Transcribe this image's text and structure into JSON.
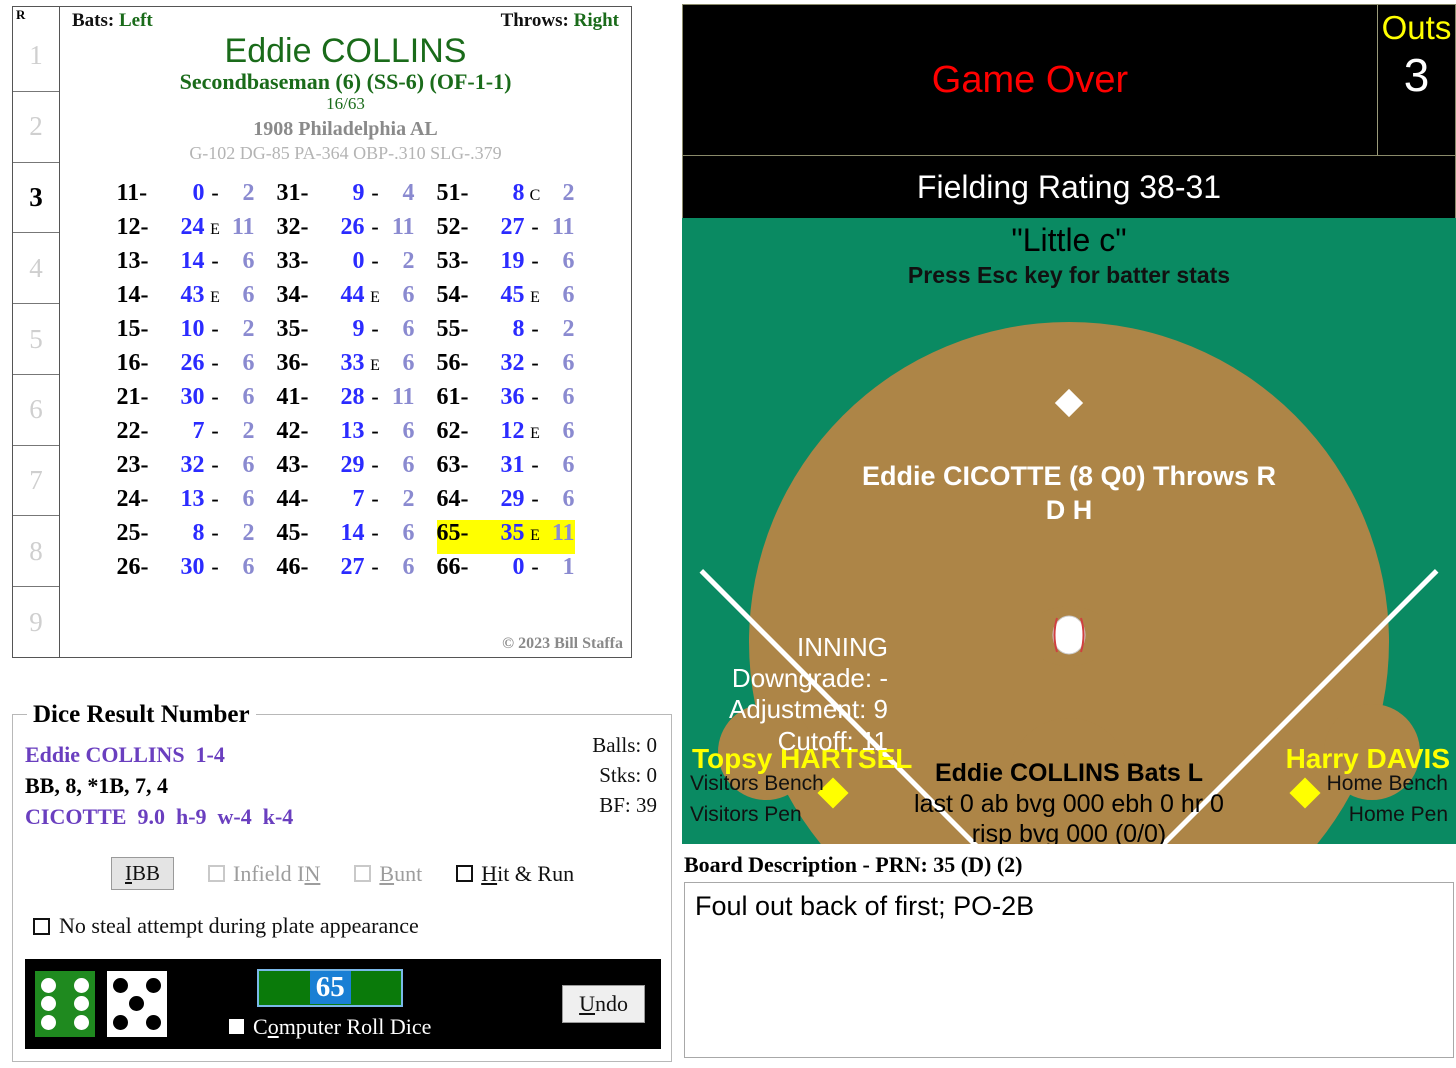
{
  "card": {
    "bats_label": "Bats:",
    "bats_value": "Left",
    "throws_label": "Throws:",
    "throws_value": "Right",
    "player_name": "Eddie COLLINS",
    "position": "Secondbaseman (6) (SS-6) (OF-1-1)",
    "ratio": "16/63",
    "team": "1908 Philadelphia AL",
    "stats_line": "G-102 DG-85 PA-364 OBP-.310 SLG-.379",
    "copyright": "© 2023 Bill Staffa",
    "inning_header": "R",
    "innings": [
      "1",
      "2",
      "3",
      "4",
      "5",
      "6",
      "7",
      "8",
      "9"
    ],
    "current_inning": "3",
    "dice_columns": [
      [
        {
          "key": "11-",
          "main": "0",
          "mid": "-",
          "sec": "2"
        },
        {
          "key": "12-",
          "main": "24",
          "mid": "E",
          "sec": "11"
        },
        {
          "key": "13-",
          "main": "14",
          "mid": "-",
          "sec": "6"
        },
        {
          "key": "14-",
          "main": "43",
          "mid": "E",
          "sec": "6"
        },
        {
          "key": "15-",
          "main": "10",
          "mid": "-",
          "sec": "2"
        },
        {
          "key": "16-",
          "main": "26",
          "mid": "-",
          "sec": "6"
        },
        {
          "key": "21-",
          "main": "30",
          "mid": "-",
          "sec": "6"
        },
        {
          "key": "22-",
          "main": "7",
          "mid": "-",
          "sec": "2"
        },
        {
          "key": "23-",
          "main": "32",
          "mid": "-",
          "sec": "6"
        },
        {
          "key": "24-",
          "main": "13",
          "mid": "-",
          "sec": "6"
        },
        {
          "key": "25-",
          "main": "8",
          "mid": "-",
          "sec": "2"
        },
        {
          "key": "26-",
          "main": "30",
          "mid": "-",
          "sec": "6"
        }
      ],
      [
        {
          "key": "31-",
          "main": "9",
          "mid": "-",
          "sec": "4"
        },
        {
          "key": "32-",
          "main": "26",
          "mid": "-",
          "sec": "11"
        },
        {
          "key": "33-",
          "main": "0",
          "mid": "-",
          "sec": "2"
        },
        {
          "key": "34-",
          "main": "44",
          "mid": "E",
          "sec": "6"
        },
        {
          "key": "35-",
          "main": "9",
          "mid": "-",
          "sec": "6"
        },
        {
          "key": "36-",
          "main": "33",
          "mid": "E",
          "sec": "6"
        },
        {
          "key": "41-",
          "main": "28",
          "mid": "-",
          "sec": "11"
        },
        {
          "key": "42-",
          "main": "13",
          "mid": "-",
          "sec": "6"
        },
        {
          "key": "43-",
          "main": "29",
          "mid": "-",
          "sec": "6"
        },
        {
          "key": "44-",
          "main": "7",
          "mid": "-",
          "sec": "2"
        },
        {
          "key": "45-",
          "main": "14",
          "mid": "-",
          "sec": "6"
        },
        {
          "key": "46-",
          "main": "27",
          "mid": "-",
          "sec": "6"
        }
      ],
      [
        {
          "key": "51-",
          "main": "8",
          "mid": "C",
          "sec": "2"
        },
        {
          "key": "52-",
          "main": "27",
          "mid": "-",
          "sec": "11"
        },
        {
          "key": "53-",
          "main": "19",
          "mid": "-",
          "sec": "6"
        },
        {
          "key": "54-",
          "main": "45",
          "mid": "E",
          "sec": "6"
        },
        {
          "key": "55-",
          "main": "8",
          "mid": "-",
          "sec": "2"
        },
        {
          "key": "56-",
          "main": "32",
          "mid": "-",
          "sec": "6"
        },
        {
          "key": "61-",
          "main": "36",
          "mid": "-",
          "sec": "6"
        },
        {
          "key": "62-",
          "main": "12",
          "mid": "E",
          "sec": "6"
        },
        {
          "key": "63-",
          "main": "31",
          "mid": "-",
          "sec": "6"
        },
        {
          "key": "64-",
          "main": "29",
          "mid": "-",
          "sec": "6"
        },
        {
          "key": "65-",
          "main": "35",
          "mid": "E",
          "sec": "11",
          "highlight": true
        },
        {
          "key": "66-",
          "main": "0",
          "mid": "-",
          "sec": "1"
        }
      ]
    ]
  },
  "dice_panel": {
    "legend": "Dice Result Number",
    "batter_line": "Eddie COLLINS  1-4",
    "result_line": "BB, 8, *1B, 7, 4",
    "pitcher_line": "CICOTTE  9.0  h-9  w-4  k-4",
    "balls": "Balls: 0",
    "strikes": "Stks: 0",
    "bf": "BF: 39",
    "ibb_label": "IBB",
    "infield_in_label": "Infield IN",
    "bunt_label": "Bunt",
    "hit_and_run_label": "Hit & Run",
    "no_steal_label": "No steal attempt during plate appearance",
    "computer_roll_label": "Computer Roll Dice",
    "undo_label": "Undo",
    "roll_value": "65",
    "die_green_value": 6,
    "die_white_value": 5
  },
  "scoreboard": {
    "game_status": "Game Over",
    "outs_label": "Outs",
    "outs_value": "3",
    "fielding_rating": "Fielding Rating 38-31"
  },
  "field": {
    "little_c": "\"Little c\"",
    "esc_hint": "Press Esc key for batter stats",
    "pitcher_name": "Eddie CICOTTE (8 Q0) Throws R",
    "pitcher_sub": "D H",
    "runner_third": "Topsy HARTSEL",
    "runner_first": "Harry DAVIS",
    "inning_title": "INNING",
    "downgrade": "Downgrade: -",
    "adjustment": "Adjustment: 9",
    "cutoff": "Cutoff: 11",
    "batter_name": "Eddie COLLINS Bats L",
    "batter_stats_1": "last 0 ab bvg 000 ebh 0 hr 0",
    "batter_stats_2": "risp bvg 000 (0/0)",
    "visitors_bench": "Visitors Bench",
    "visitors_pen": "Visitors Pen",
    "home_bench": "Home Bench",
    "home_pen": "Home Pen"
  },
  "board": {
    "title": "Board Description - PRN: 35 (D) (2)",
    "description": "Foul out back of first; PO-2B"
  },
  "colors": {
    "field_green": "#0a8a62",
    "dirt": "#ad8547",
    "highlight_yellow": "#ffff00",
    "game_status_red": "#ff0000",
    "card_green": "#1a6b1a",
    "dice_blue": "#2b2bff"
  }
}
